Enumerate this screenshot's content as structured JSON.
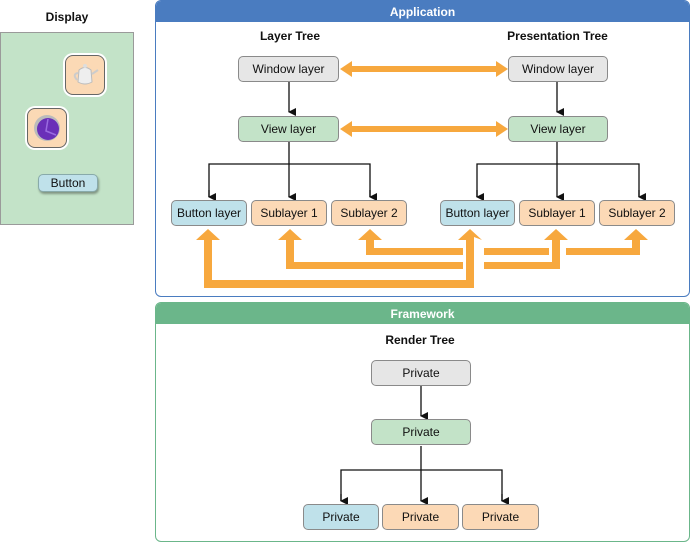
{
  "display": {
    "title": "Display",
    "icons": [
      "teapot-icon",
      "purple-orb-icon"
    ],
    "button_label": "Button"
  },
  "application": {
    "header": "Application",
    "header_color": "#4a7cc0",
    "layer_tree": {
      "title": "Layer Tree",
      "window": "Window layer",
      "view": "View layer",
      "children": [
        "Button layer",
        "Sublayer 1",
        "Sublayer 2"
      ]
    },
    "presentation_tree": {
      "title": "Presentation Tree",
      "window": "Window layer",
      "view": "View layer",
      "children": [
        "Button layer",
        "Sublayer 1",
        "Sublayer 2"
      ]
    },
    "arrow_color": "#f7a83e"
  },
  "framework": {
    "header": "Framework",
    "header_color": "#6bb68a",
    "render_tree": {
      "title": "Render Tree",
      "root": "Private",
      "mid": "Private",
      "children": [
        "Private",
        "Private",
        "Private"
      ]
    }
  }
}
